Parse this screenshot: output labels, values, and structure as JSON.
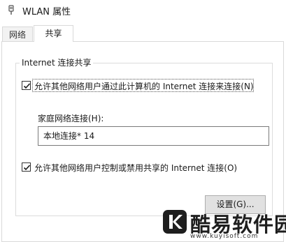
{
  "window": {
    "title": "WLAN 属性",
    "title_icon": "network-adapter-icon"
  },
  "tabs": [
    {
      "label": "网络",
      "active": false
    },
    {
      "label": "共享",
      "active": true
    }
  ],
  "sharing": {
    "group_title": "Internet 连接共享",
    "allow_share": {
      "checked": true,
      "label": "允许其他网络用户通过此计算机的 Internet 连接来连接(N)"
    },
    "home_network_label": "家庭网络连接(H):",
    "home_network_value": "本地连接* 14",
    "allow_control": {
      "checked": true,
      "label": "允许其他网络用户控制或禁用共享的 Internet 连接(O)"
    },
    "settings_button": "设置(G)..."
  },
  "watermark": {
    "brand_text": "酷易软件园",
    "url": "www.kuyisoft.com"
  },
  "colors": {
    "border": "#d9d9d9",
    "button_bg": "#e1e1e1",
    "text": "#1a1a1a"
  }
}
